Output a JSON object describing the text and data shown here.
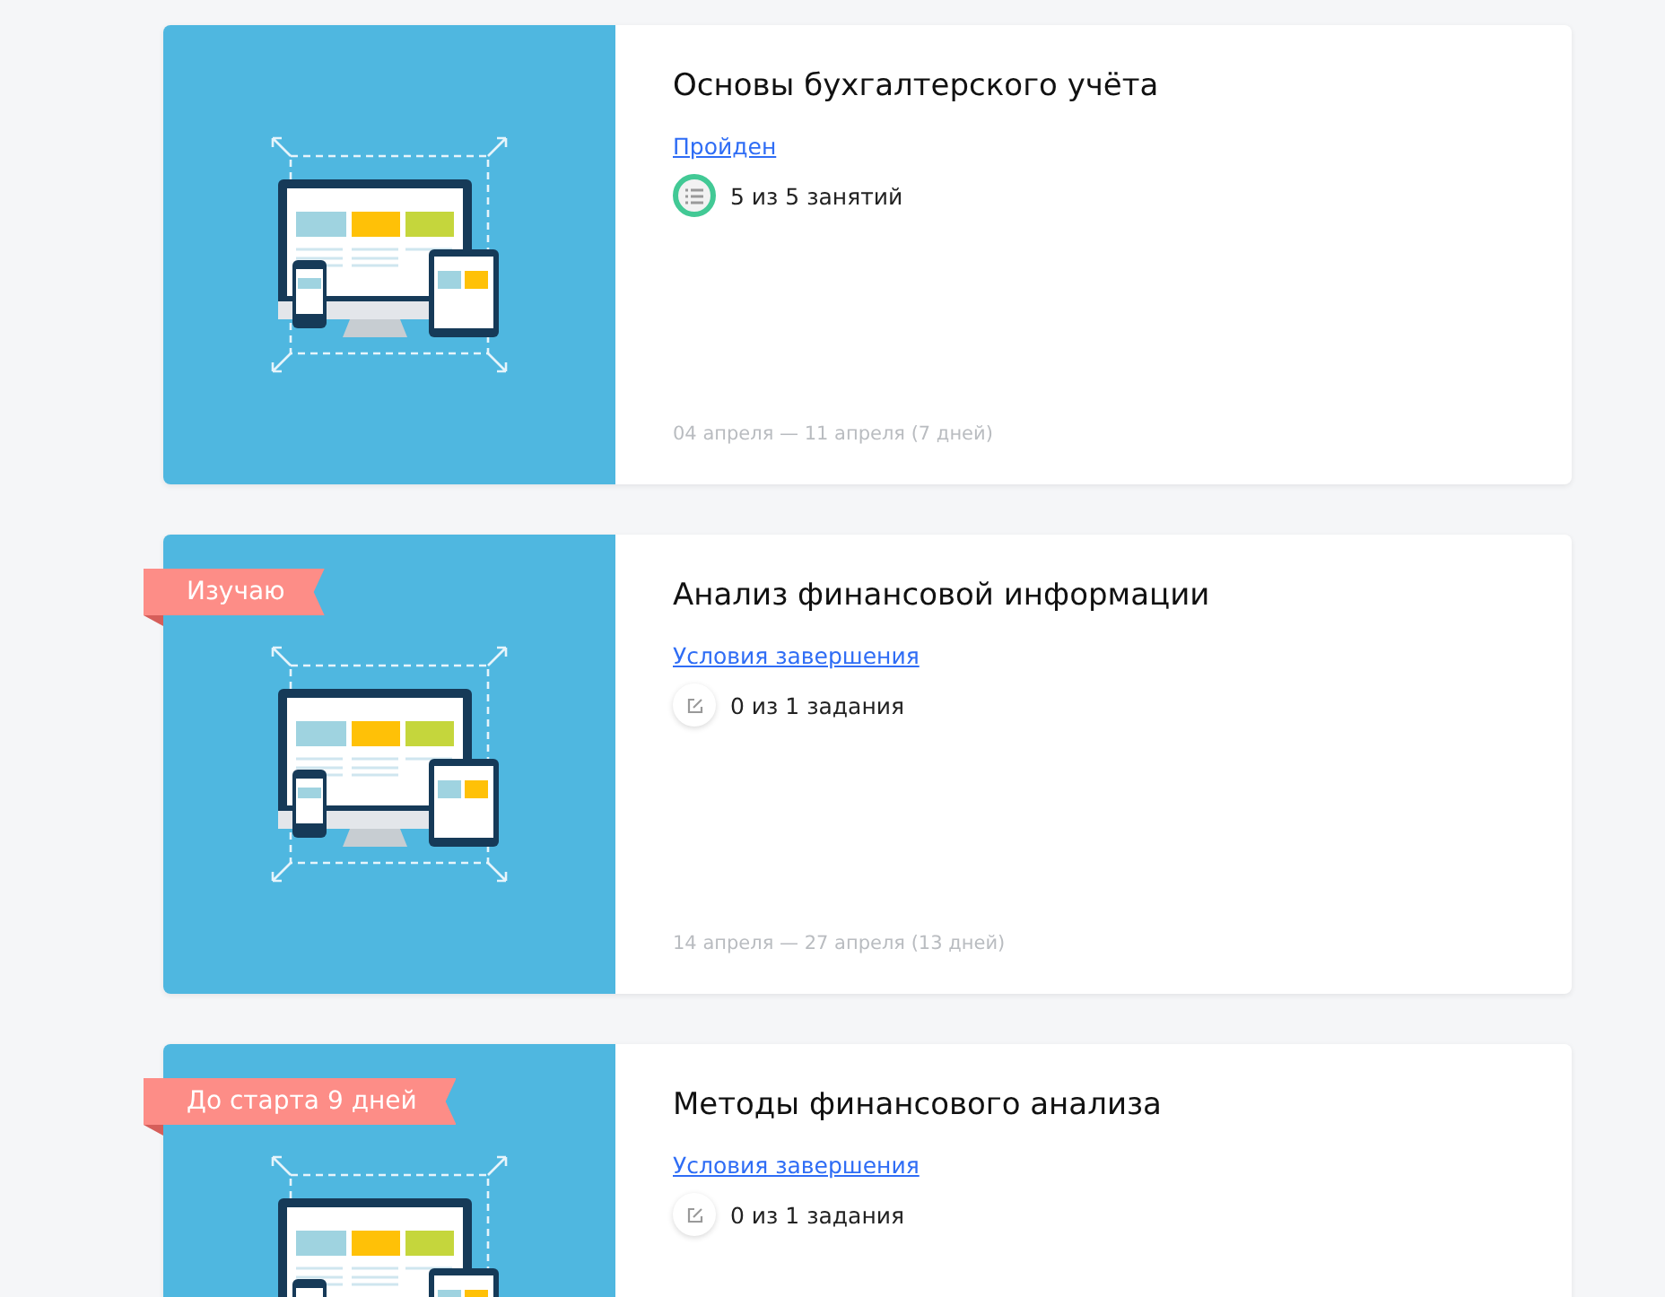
{
  "courses": [
    {
      "title": "Основы бухгалтерского учёта",
      "link": "Пройден",
      "progress": {
        "kind": "lessons",
        "complete": true,
        "text": "5 из 5 занятий"
      },
      "dates": "04 апреля — 11 апреля (7 дней)"
    },
    {
      "badge": "Изучаю",
      "title": "Анализ финансовой информации",
      "link": "Условия завершения",
      "progress": {
        "kind": "task",
        "complete": false,
        "text": "0 из 1 задания"
      },
      "dates": "14 апреля — 27 апреля (13 дней)"
    },
    {
      "badge": "До старта 9 дней",
      "title": "Методы финансового анализа",
      "link": "Условия завершения",
      "progress": {
        "kind": "task",
        "complete": false,
        "text": "0 из 1 задания"
      }
    }
  ]
}
